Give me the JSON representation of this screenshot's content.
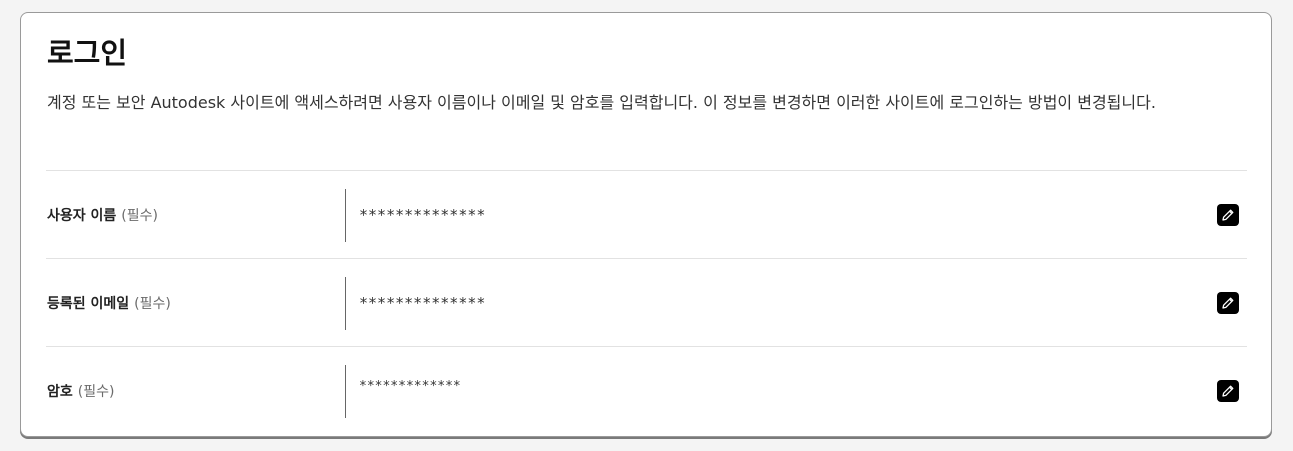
{
  "login": {
    "title": "로그인",
    "description": "계정 또는 보안 Autodesk 사이트에 액세스하려면 사용자 이름이나 이메일 및 암호를 입력합니다. 이 정보를 변경하면 이러한 사이트에 로그인하는 방법이 변경됩니다.",
    "fields": [
      {
        "label": "사용자 이름",
        "required": "(필수)",
        "value": "**************",
        "icon": "pencil-icon"
      },
      {
        "label": "등록된 이메일",
        "required": "(필수)",
        "value": "**************",
        "icon": "pencil-icon"
      },
      {
        "label": "암호",
        "required": "(필수)",
        "value": "*************",
        "icon": "pencil-icon"
      }
    ]
  },
  "colors": {
    "background": "#f4f4f4",
    "card": "#ffffff",
    "edit_button": "#000000"
  }
}
